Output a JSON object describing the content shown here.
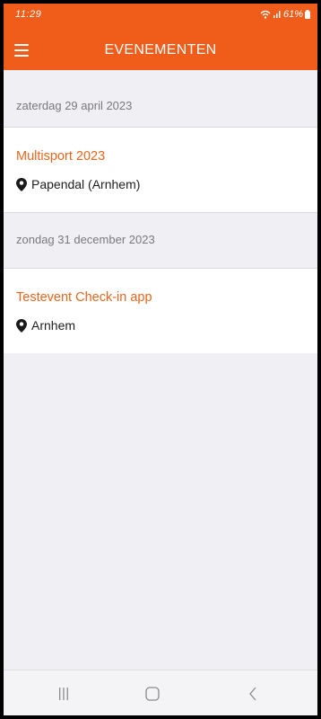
{
  "status_bar": {
    "time": "11:29",
    "battery": "61%"
  },
  "app_bar": {
    "title": "EVENEMENTEN"
  },
  "groups": [
    {
      "date": "zaterdag 29 april 2023",
      "event": {
        "title": "Multisport 2023",
        "location": "Papendal (Arnhem)"
      }
    },
    {
      "date": "zondag 31 december 2023",
      "event": {
        "title": "Testevent Check-in app",
        "location": "Arnhem"
      }
    }
  ],
  "colors": {
    "accent": "#f05c1a",
    "event_title": "#e8661e",
    "background": "#efeff4"
  },
  "icons": {
    "menu": "hamburger-menu-icon",
    "location": "map-pin-icon",
    "nav_recent": "recent-apps-icon",
    "nav_home": "home-icon",
    "nav_back": "back-icon"
  }
}
